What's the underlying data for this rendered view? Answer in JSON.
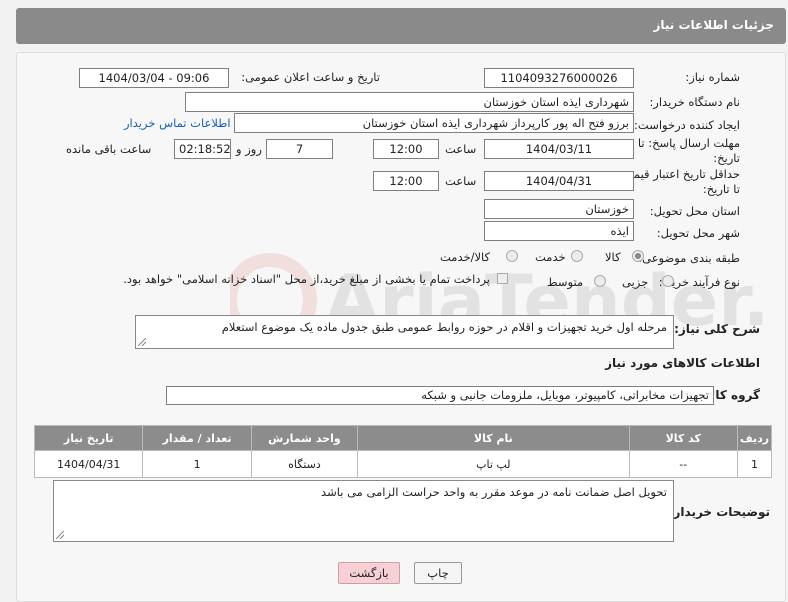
{
  "header": {
    "title": "جزئیات اطلاعات نیاز"
  },
  "fields": {
    "need_number_label": "شماره نیاز:",
    "need_number": "1104093276000026",
    "announce_label": "تاریخ و ساعت اعلان عمومی:",
    "announce_value": "1404/03/04 - 09:06",
    "buyer_org_label": "نام دستگاه خریدار:",
    "buyer_org": "شهرداری ایذه استان خوزستان",
    "requester_label": "ایجاد کننده درخواست:",
    "requester": "برزو فتح اله پور کارپرداز شهرداری ایذه استان خوزستان",
    "contact_link": "اطلاعات تماس خریدار",
    "deadline_label_1": "مهلت ارسال پاسخ: تا",
    "deadline_label_2": "تاریخ:",
    "deadline_date": "1404/03/11",
    "time_label": "ساعت",
    "deadline_time": "12:00",
    "days_value": "7",
    "days_label": "روز و",
    "remaining_time": "02:18:52",
    "remaining_label": "ساعت باقی مانده",
    "validity_label_1": "حداقل تاریخ اعتبار قیمت:",
    "validity_label_2": "تا تاریخ:",
    "validity_date": "1404/04/31",
    "validity_time": "12:00",
    "province_label": "استان محل تحویل:",
    "province": "خوزستان",
    "city_label": "شهر محل تحویل:",
    "city": "ایذه",
    "category_label": "طبقه بندی موضوعی:",
    "category_options": [
      "کالا",
      "خدمت",
      "کالا/خدمت"
    ],
    "process_label": "نوع فرآیند خرید :",
    "process_options": [
      "جزیی",
      "متوسط"
    ],
    "payment_note": "پرداخت تمام یا بخشی از مبلغ خرید،از محل \"اسناد خزانه اسلامی\" خواهد بود."
  },
  "description": {
    "label": "شرح کلی نیاز:",
    "text": "مرحله اول خرید تجهیزات و اقلام در حوزه روابط عمومی طبق جدول ماده یک موضوع استعلام"
  },
  "goods": {
    "section_title": "اطلاعات کالاهای مورد نیاز",
    "group_label": "گروه کالا:",
    "group_value": "تجهیزات مخابراتی، کامپیوتر، موبایل، ملزومات جانبی و شبکه",
    "columns": [
      "ردیف",
      "کد کالا",
      "نام کالا",
      "واحد شمارش",
      "تعداد / مقدار",
      "تاریخ نیاز"
    ],
    "rows": [
      [
        "1",
        "--",
        "لپ تاپ",
        "دستگاه",
        "1",
        "1404/04/31"
      ]
    ]
  },
  "buyer_notes": {
    "label": "توضیحات خریدار:",
    "text": "تحویل اصل ضمانت نامه در موعد مقرر به واحد حراست الزامی می باشد"
  },
  "buttons": {
    "print": "چاپ",
    "back": "بازگشت"
  },
  "watermark": {
    "text": "AriaTender.neT"
  },
  "colors": {
    "header_bg": "#8a8a8a",
    "table_header_bg": "#8c8c8c",
    "back_button_bg": "#f6d0d5",
    "link": "#1a5fb4"
  }
}
